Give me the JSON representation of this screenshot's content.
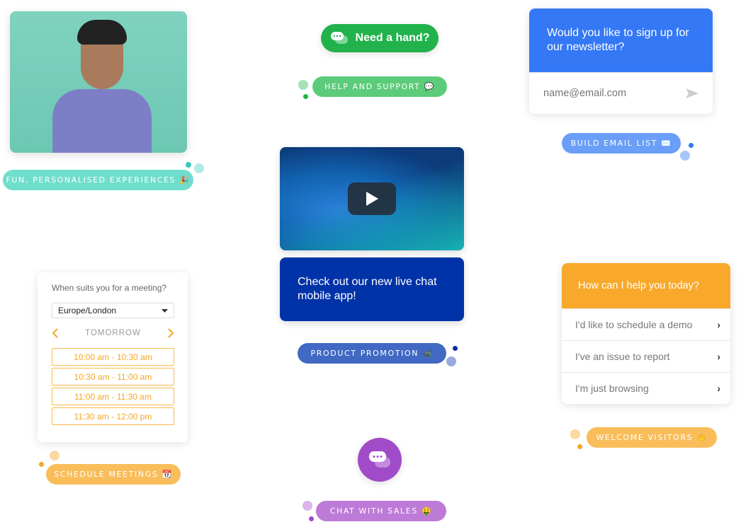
{
  "colors": {
    "teal": "#6fdecc",
    "green": "#22b24c",
    "green_light": "#5ccc7a",
    "blue": "#3478f6",
    "blue_light": "#6a9ef8",
    "navy": "#0033a8",
    "product": "#4169c4",
    "orange": "#f8a92b",
    "orange_light": "#f9bd5a",
    "purple": "#a04bc8",
    "purple_light": "#bd7ad6"
  },
  "fun": {
    "label": "FUN, PERSONALISED EXPERIENCES 🎉"
  },
  "need_hand": {
    "label": "Need a hand?",
    "icon": "chat-bubbles-icon"
  },
  "help": {
    "label": "HELP AND SUPPORT 💬"
  },
  "newsletter": {
    "title": "Would you like to sign up for our newsletter?",
    "placeholder": "name@email.com",
    "icon": "send-icon"
  },
  "email_list": {
    "label": "BUILD EMAIL LIST ✉️"
  },
  "promo": {
    "text": "Check out our new live chat mobile app!",
    "label": "PRODUCT PROMOTION 📹"
  },
  "scheduler": {
    "question": "When suits you for a meeting?",
    "timezone": "Europe/London",
    "day": "TOMORROW",
    "slots": [
      "10:00 am - 10:30 am",
      "10:30 am - 11:00 am",
      "11:00 am - 11:30 am",
      "11:30 am - 12:00 pm"
    ],
    "label": "SCHEDULE MEETINGS 📆"
  },
  "helper": {
    "title": "How can I help you today?",
    "options": [
      "I'd like to schedule a demo",
      "I've an issue to report",
      "I'm just browsing"
    ],
    "label": "WELCOME VISITORS 👋"
  },
  "chat": {
    "label": "CHAT WITH SALES 🤑"
  }
}
